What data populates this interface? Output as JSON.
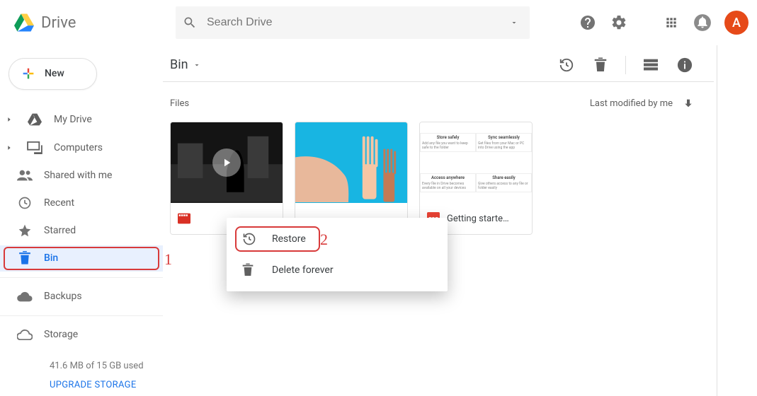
{
  "product": {
    "name": "Drive"
  },
  "search": {
    "placeholder": "Search Drive"
  },
  "avatar_letter": "A",
  "new_button_label": "New",
  "sidebar": {
    "items": [
      {
        "label": "My Drive"
      },
      {
        "label": "Computers"
      },
      {
        "label": "Shared with me"
      },
      {
        "label": "Recent"
      },
      {
        "label": "Starred"
      },
      {
        "label": "Bin"
      },
      {
        "label": "Backups"
      }
    ],
    "storage_label": "Storage",
    "storage_usage": "41.6 MB of 15 GB used",
    "storage_upgrade": "UPGRADE STORAGE"
  },
  "breadcrumb": {
    "current": "Bin"
  },
  "section": {
    "title": "Files",
    "sort": "Last modified by me"
  },
  "files": [
    {
      "name": "",
      "type": "video"
    },
    {
      "name": "",
      "type": "image"
    },
    {
      "name": "Getting starte…",
      "type": "pdf",
      "info_tiles": [
        "Store safely",
        "Sync seamlessly",
        "Access anywhere",
        "Share easily"
      ]
    }
  ],
  "context_menu": {
    "items": [
      {
        "label": "Restore"
      },
      {
        "label": "Delete forever"
      }
    ]
  },
  "annotations": {
    "step1": "1",
    "step2": "2"
  }
}
